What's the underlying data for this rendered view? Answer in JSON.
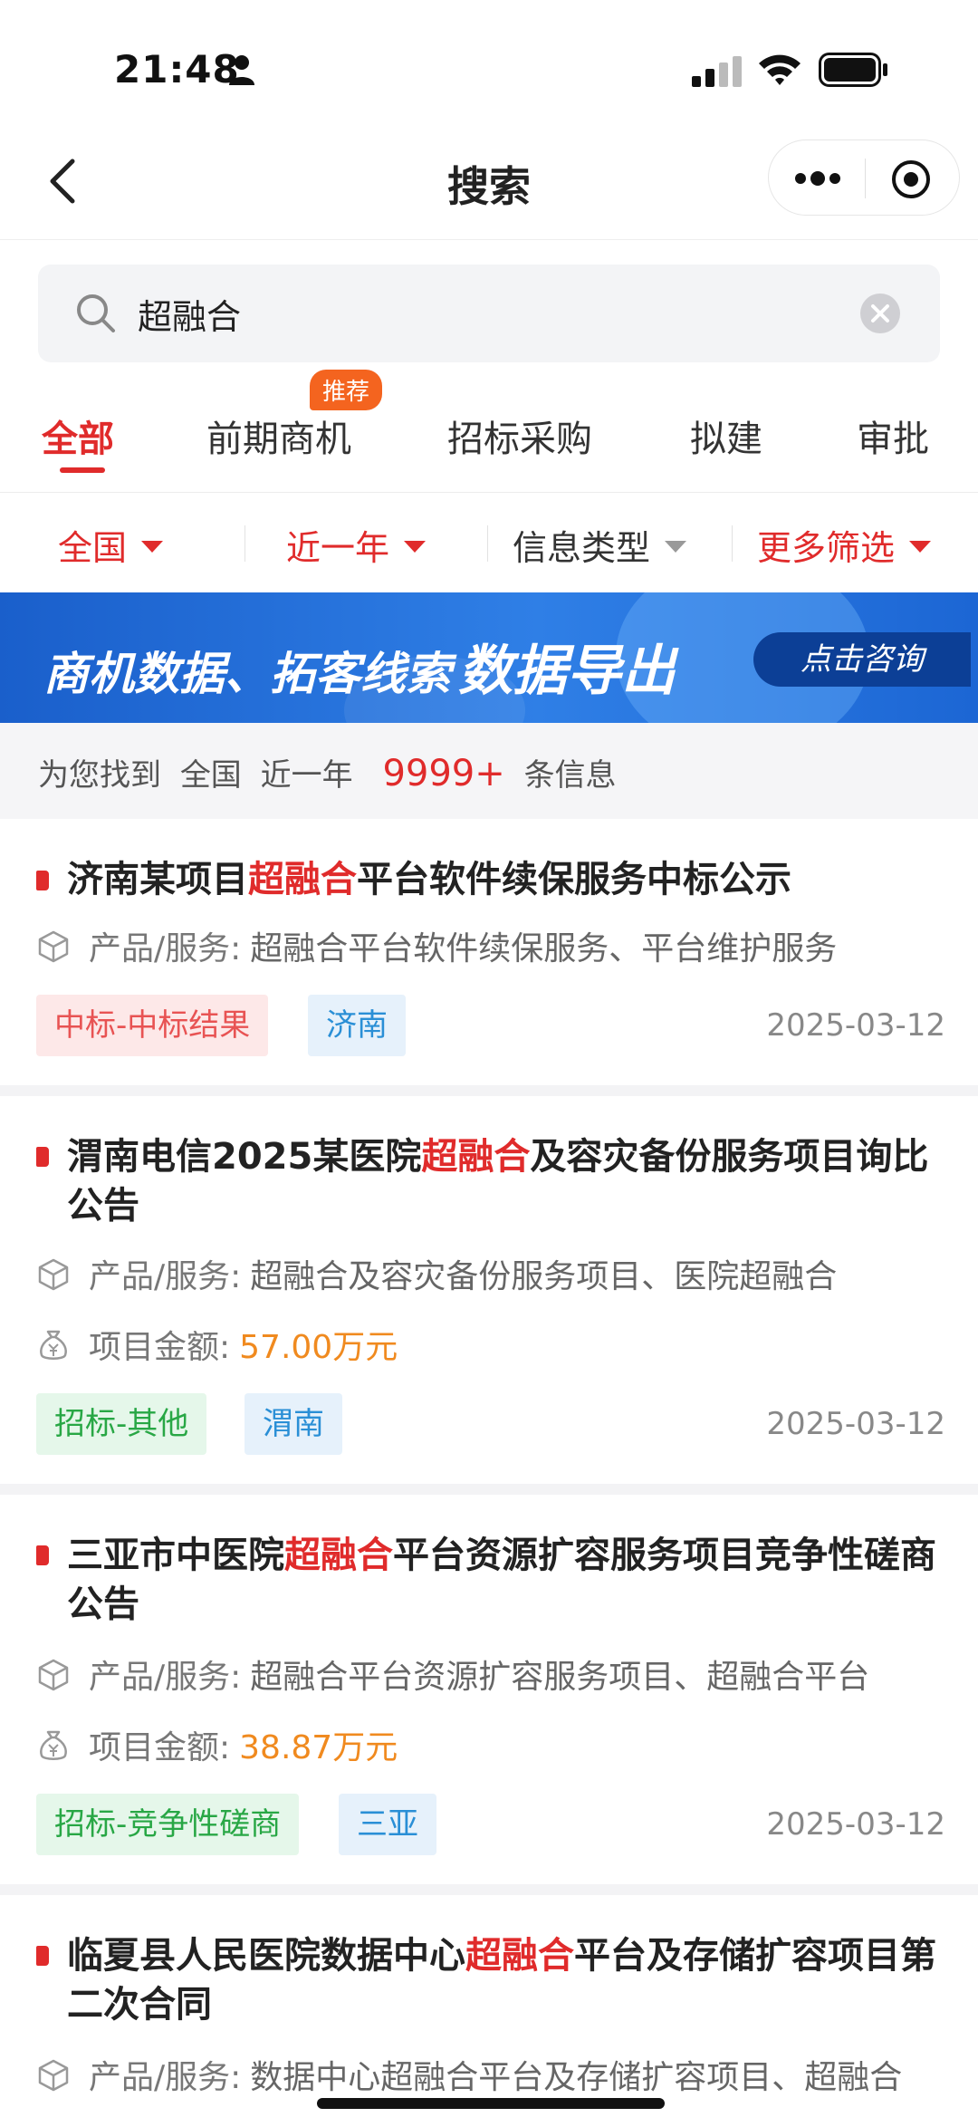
{
  "status_bar": {
    "time": "21:48"
  },
  "nav": {
    "title": "搜索"
  },
  "search": {
    "value": "超融合"
  },
  "tabs": [
    {
      "label": "全部",
      "active": true
    },
    {
      "label": "前期商机",
      "badge": "推荐"
    },
    {
      "label": "招标采购"
    },
    {
      "label": "拟建"
    },
    {
      "label": "审批"
    }
  ],
  "filters": [
    {
      "label": "全国",
      "color": "#e02b2b"
    },
    {
      "label": "近一年",
      "color": "#e02b2b"
    },
    {
      "label": "信息类型",
      "color": "#333333"
    },
    {
      "label": "更多筛选",
      "color": "#e02b2b"
    }
  ],
  "banner": {
    "text_main": "商机数据、拓客线索",
    "text_emphasis": "数据导出",
    "cta": "点击咨询"
  },
  "summary": {
    "prefix": "为您找到",
    "region": "全国",
    "period": "近一年",
    "count": "9999+",
    "suffix": "条信息"
  },
  "results": [
    {
      "title_before": "济南某项目",
      "title_keyword": "超融合",
      "title_after": "平台软件续保服务中标公示",
      "product_label": "产品/服务:",
      "product_value": "超融合平台软件续保服务、平台维护服务",
      "tags": [
        {
          "label": "中标-中标结果",
          "style": "red"
        },
        {
          "label": "济南",
          "style": "blue"
        }
      ],
      "date": "2025-03-12"
    },
    {
      "title_before": "渭南电信2025某医院",
      "title_keyword": "超融合",
      "title_after": "及容灾备份服务项目询比公告",
      "product_label": "产品/服务:",
      "product_value": "超融合及容灾备份服务项目、医院超融合",
      "amount_label": "项目金额:",
      "amount_value": "57.00万元",
      "tags": [
        {
          "label": "招标-其他",
          "style": "green"
        },
        {
          "label": "渭南",
          "style": "blue"
        }
      ],
      "date": "2025-03-12"
    },
    {
      "title_before": "三亚市中医院",
      "title_keyword": "超融合",
      "title_after": "平台资源扩容服务项目竞争性磋商公告",
      "product_label": "产品/服务:",
      "product_value": "超融合平台资源扩容服务项目、超融合平台",
      "amount_label": "项目金额:",
      "amount_value": "38.87万元",
      "tags": [
        {
          "label": "招标-竞争性磋商",
          "style": "green"
        },
        {
          "label": "三亚",
          "style": "blue"
        }
      ],
      "date": "2025-03-12"
    },
    {
      "title_before": "临夏县人民医院数据中心",
      "title_keyword": "超融合",
      "title_after": "平台及存储扩容项目第二次合同",
      "product_label": "产品/服务:",
      "product_value": "数据中心超融合平台及存储扩容项目、超融合"
    }
  ]
}
